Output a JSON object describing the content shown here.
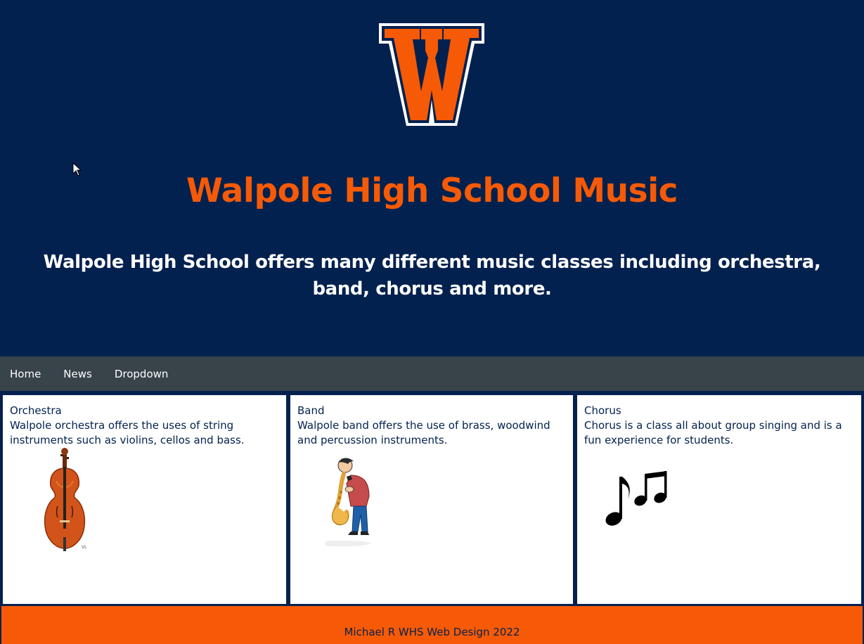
{
  "header": {
    "logo_letter": "W",
    "title": "Walpole High School Music",
    "subtitle": "Walpole High School offers many different music classes including orchestra, band, chorus and more."
  },
  "nav": {
    "items": [
      {
        "label": "Home"
      },
      {
        "label": "News"
      },
      {
        "label": "Dropdown"
      }
    ]
  },
  "cards": [
    {
      "title": "Orchestra",
      "description": "Walpole orchestra offers the uses of string instruments such as violins, cellos and bass.",
      "image": "cello-image"
    },
    {
      "title": "Band",
      "description": "Walpole band offers the use of brass, woodwind and percussion instruments.",
      "image": "saxophone-player-image"
    },
    {
      "title": "Chorus",
      "description": "Chorus is a class all about group singing and is a fun experience for students.",
      "image": "music-notes-image"
    }
  ],
  "footer": {
    "text": "Michael R WHS Web Design 2022"
  },
  "colors": {
    "navy": "#03214f",
    "orange": "#f65a06",
    "nav_bg": "#38434a",
    "white": "#ffffff"
  }
}
